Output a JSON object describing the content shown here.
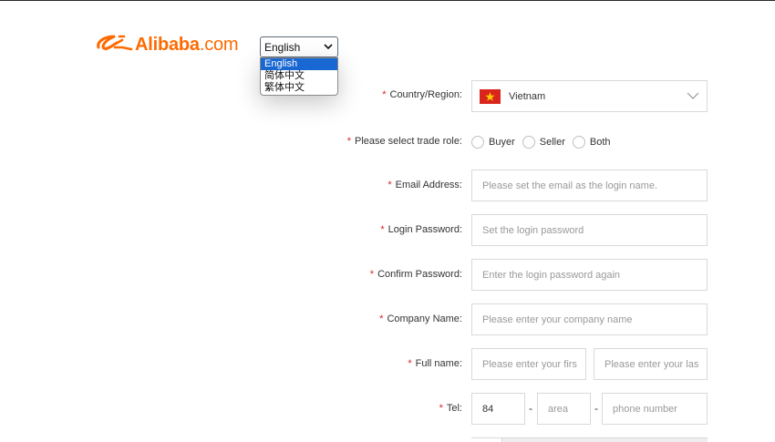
{
  "brand": {
    "name": "Alibaba",
    "suffix": ".com",
    "color": "#ff6a00"
  },
  "language": {
    "selected": "English",
    "options": [
      "English",
      "简体中文",
      "繁体中文"
    ]
  },
  "form": {
    "required_mark": "*",
    "country": {
      "label": "Country/Region:",
      "value": "Vietnam",
      "flag_icon": "vietnam-flag-icon"
    },
    "trade_role": {
      "label": "Please select trade role:",
      "options": [
        "Buyer",
        "Seller",
        "Both"
      ]
    },
    "email": {
      "label": "Email Address:",
      "placeholder": "Please set the email as the login name."
    },
    "password": {
      "label": "Login Password:",
      "placeholder": "Set the login password"
    },
    "confirm_password": {
      "label": "Confirm Password:",
      "placeholder": "Enter the login password again"
    },
    "company": {
      "label": "Company Name:",
      "placeholder": "Please enter your company name"
    },
    "full_name": {
      "label": "Full name:",
      "first_placeholder": "Please enter your firs",
      "last_placeholder": "Please enter your las"
    },
    "tel": {
      "label": "Tel:",
      "country_code": "84",
      "area_placeholder": "area",
      "number_placeholder": "phone number",
      "separator": "-"
    }
  },
  "colors": {
    "required": "#e02020",
    "selection": "#1967d2",
    "border": "#d9d9d9"
  }
}
